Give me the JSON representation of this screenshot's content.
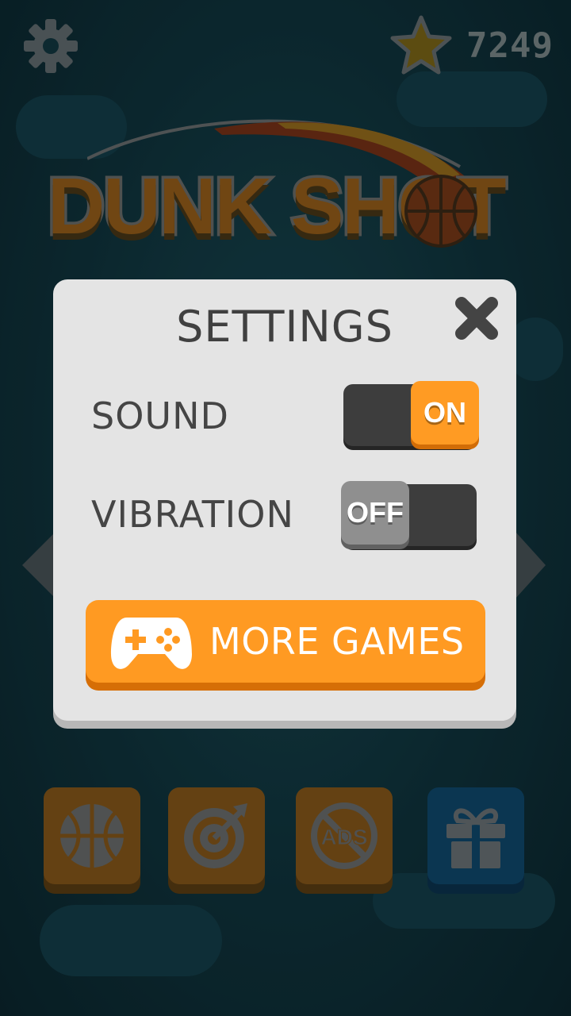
{
  "top_bar": {
    "settings_icon": "gear-icon",
    "coin_icon": "star-icon",
    "coin_count": "7249"
  },
  "logo": {
    "text": "DUNK SHOT"
  },
  "settings_modal": {
    "title": "SETTINGS",
    "close_icon": "close-x-icon",
    "sound": {
      "label": "SOUND",
      "state": "ON"
    },
    "vibration": {
      "label": "VIBRATION",
      "state": "OFF"
    },
    "more_games": {
      "label": "MORE GAMES",
      "icon": "gamepad-icon"
    }
  },
  "bottom_tiles": [
    {
      "icon": "basketball-icon"
    },
    {
      "icon": "target-icon"
    },
    {
      "icon": "no-ads-icon",
      "text": "ADS"
    },
    {
      "icon": "gift-icon"
    }
  ],
  "colors": {
    "accent": "#ff9a22",
    "modal_bg": "#e4e4e4",
    "toggle_track": "#3d3d3d",
    "tile_orange": "#8a5412",
    "tile_blue": "#0f4469"
  }
}
